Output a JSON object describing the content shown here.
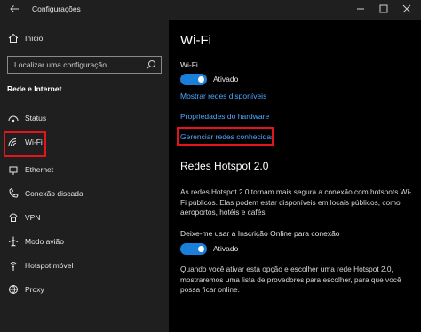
{
  "window": {
    "title": "Configurações"
  },
  "sidebar": {
    "home_label": "Início",
    "search_placeholder": "Localizar uma configuração",
    "section_title": "Rede e Internet",
    "items": [
      {
        "label": "Status",
        "icon": "status-icon"
      },
      {
        "label": "Wi-Fi",
        "icon": "wifi-icon"
      },
      {
        "label": "Ethernet",
        "icon": "ethernet-icon"
      },
      {
        "label": "Conexão discada",
        "icon": "dialup-icon"
      },
      {
        "label": "VPN",
        "icon": "vpn-icon"
      },
      {
        "label": "Modo avião",
        "icon": "airplane-icon"
      },
      {
        "label": "Hotspot móvel",
        "icon": "hotspot-icon"
      },
      {
        "label": "Proxy",
        "icon": "proxy-icon"
      }
    ]
  },
  "main": {
    "title": "Wi-Fi",
    "wifi_label": "Wi-Fi",
    "wifi_toggle_text": "Ativado",
    "links": [
      "Mostrar redes disponíveis",
      "Propriedades do hardware",
      "Gerenciar redes conhecidas"
    ],
    "hotspot_title": "Redes Hotspot 2.0",
    "hotspot_desc": "As redes Hotspot 2.0 tornam mais segura a conexão com hotspots Wi-Fi públicos. Elas podem estar disponíveis em locais públicos, como aeroportos, hotéis e cafés.",
    "hotspot_toggle_label": "Deixe-me usar a Inscrição Online para conexão",
    "hotspot_toggle_text": "Ativado",
    "hotspot_note": "Quando você ativar esta opção e escolher uma rede Hotspot 2.0, mostraremos uma lista de provedores para escolher, para que você possa ficar online."
  },
  "colors": {
    "accent": "#1a7fd8",
    "link": "#4fa6ff",
    "highlight": "#e3141e",
    "sidebar_bg": "#1f1f1f"
  }
}
